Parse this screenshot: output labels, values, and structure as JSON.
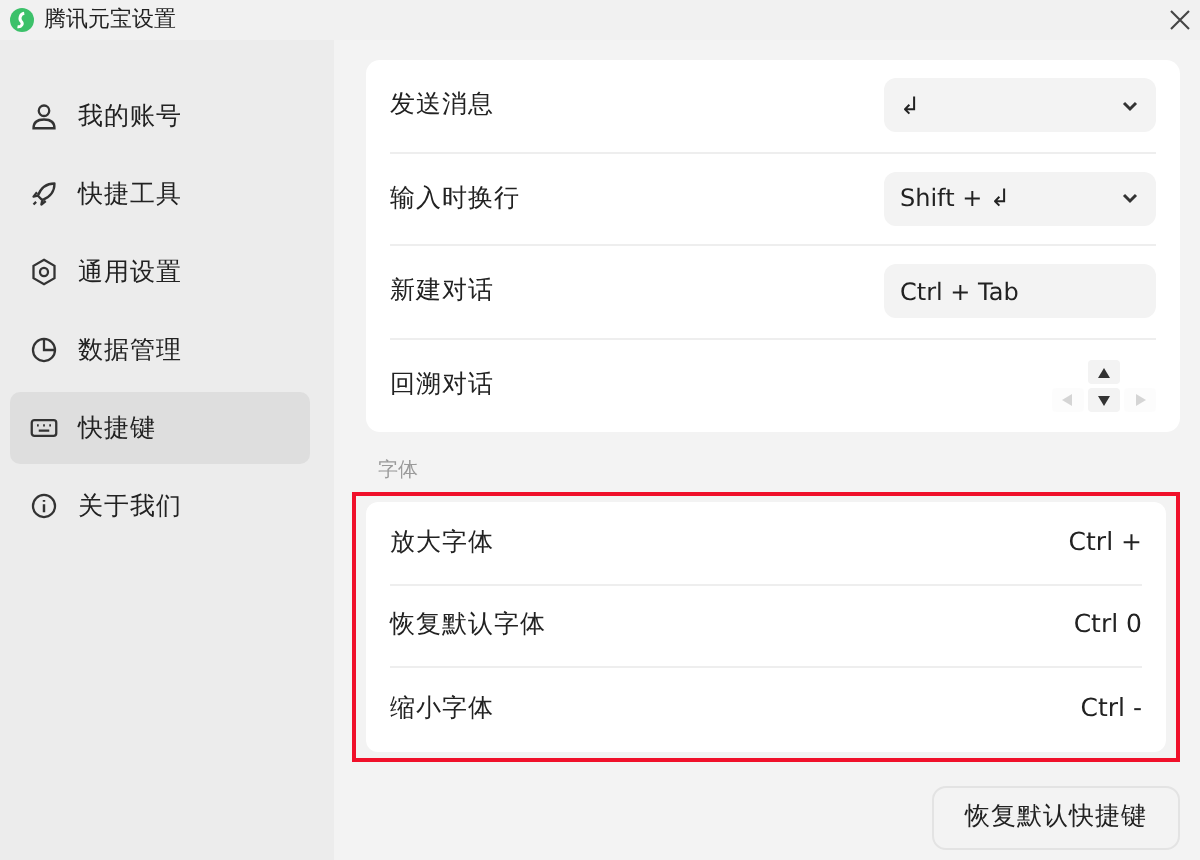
{
  "window": {
    "title": "腾讯元宝设置"
  },
  "sidebar": {
    "items": [
      {
        "label": "我的账号",
        "selected": false
      },
      {
        "label": "快捷工具",
        "selected": false
      },
      {
        "label": "通用设置",
        "selected": false
      },
      {
        "label": "数据管理",
        "selected": false
      },
      {
        "label": "快捷键",
        "selected": true
      },
      {
        "label": "关于我们",
        "selected": false
      }
    ]
  },
  "shortcuts": {
    "rows": [
      {
        "label": "发送消息",
        "kind": "select",
        "value": "↲"
      },
      {
        "label": "输入时换行",
        "kind": "select",
        "value": "Shift + ↲"
      },
      {
        "label": "新建对话",
        "kind": "input",
        "value": "Ctrl + Tab"
      },
      {
        "label": "回溯对话",
        "kind": "arrows",
        "keys": [
          {
            "kind": "up",
            "enabled": true
          },
          {
            "kind": "left",
            "enabled": false
          },
          {
            "kind": "down",
            "enabled": true
          },
          {
            "kind": "right",
            "enabled": false
          }
        ]
      }
    ]
  },
  "font": {
    "heading": "字体",
    "highlighted": true,
    "rows": [
      {
        "label": "放大字体",
        "value": "Ctrl +"
      },
      {
        "label": "恢复默认字体",
        "value": "Ctrl 0"
      },
      {
        "label": "缩小字体",
        "value": "Ctrl -"
      }
    ]
  },
  "reset_button": "恢复默认快捷键"
}
